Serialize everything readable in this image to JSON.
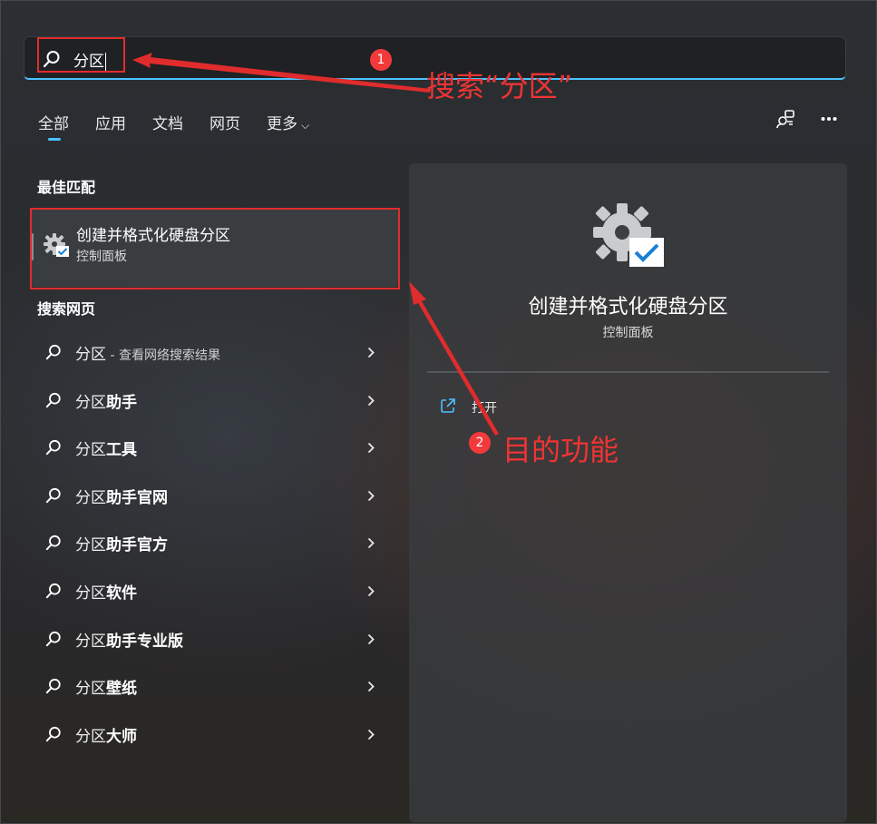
{
  "search": {
    "value": "分区"
  },
  "tabs": [
    {
      "label": "全部",
      "active": true
    },
    {
      "label": "应用"
    },
    {
      "label": "文档"
    },
    {
      "label": "网页"
    },
    {
      "label": "更多"
    }
  ],
  "top_icons": [
    "people-switch-icon",
    "more-options-icon"
  ],
  "best_match": {
    "heading": "最佳匹配",
    "title": "创建并格式化硬盘分区",
    "subtitle": "控制面板",
    "icon": "settings-gear-check-icon"
  },
  "web": {
    "heading": "搜索网页",
    "items": [
      {
        "query": "分区",
        "bold": "",
        "extra": " - 查看网络搜索结果"
      },
      {
        "query": "分区",
        "bold": "助手",
        "extra": ""
      },
      {
        "query": "分区",
        "bold": "工具",
        "extra": ""
      },
      {
        "query": "分区",
        "bold": "助手官网",
        "extra": ""
      },
      {
        "query": "分区",
        "bold": "助手官方",
        "extra": ""
      },
      {
        "query": "分区",
        "bold": "软件",
        "extra": ""
      },
      {
        "query": "分区",
        "bold": "助手专业版",
        "extra": ""
      },
      {
        "query": "分区",
        "bold": "壁纸",
        "extra": ""
      },
      {
        "query": "分区",
        "bold": "大师",
        "extra": ""
      }
    ]
  },
  "preview": {
    "title": "创建并格式化硬盘分区",
    "subtitle": "控制面板",
    "open_label": "打开"
  },
  "annotations": {
    "badge1": "1",
    "label1": "搜索“分区”",
    "badge2": "2",
    "label2": "目的功能",
    "color": "#e02c2c"
  },
  "colors": {
    "accent": "#4cc2ff",
    "annotation": "#e02c2c"
  }
}
